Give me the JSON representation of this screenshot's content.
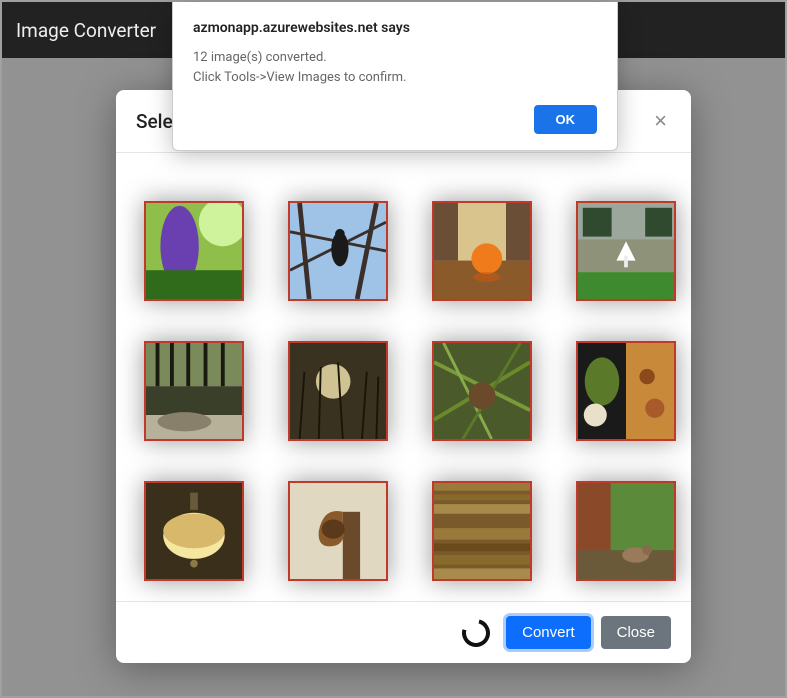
{
  "navbar": {
    "title": "Image Converter"
  },
  "modal": {
    "title": "Sele",
    "close_symbol": "×",
    "footer": {
      "convert_label": "Convert",
      "close_label": "Close"
    },
    "thumbs": [
      {
        "name": "thumb-1"
      },
      {
        "name": "thumb-2"
      },
      {
        "name": "thumb-3"
      },
      {
        "name": "thumb-4"
      },
      {
        "name": "thumb-5"
      },
      {
        "name": "thumb-6"
      },
      {
        "name": "thumb-7"
      },
      {
        "name": "thumb-8"
      },
      {
        "name": "thumb-9"
      },
      {
        "name": "thumb-10"
      },
      {
        "name": "thumb-11"
      },
      {
        "name": "thumb-12"
      }
    ]
  },
  "alert": {
    "origin": "azmonapp.azurewebsites.net says",
    "line1": "12 image(s) converted.",
    "line2": "Click Tools->View Images to confirm.",
    "ok_label": "OK"
  },
  "colors": {
    "thumb_border": "#c0392b",
    "primary": "#0d6efd",
    "alert_primary": "#1a73e8",
    "secondary": "#6c757d"
  }
}
